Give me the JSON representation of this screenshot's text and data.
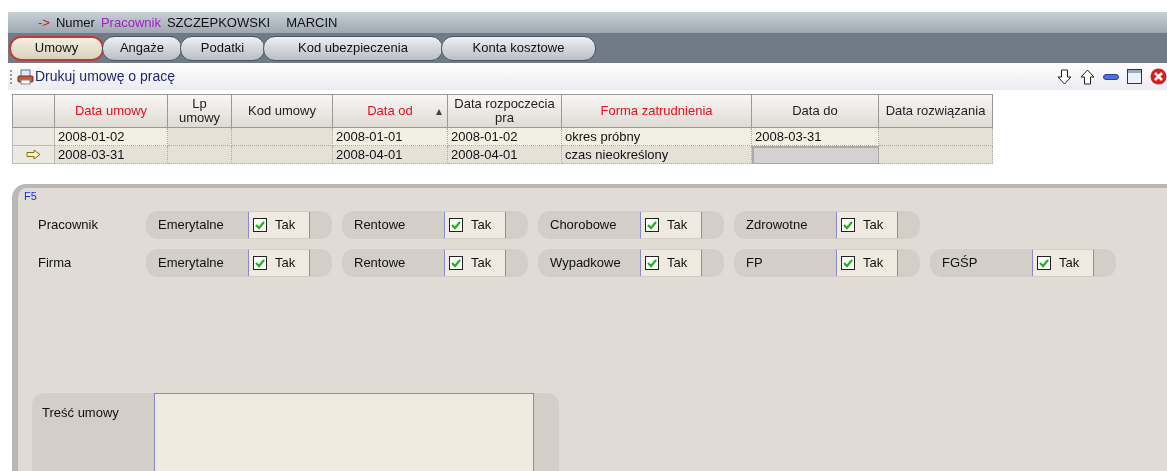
{
  "header": {
    "arrow": "->",
    "number_label": "Numer",
    "employee_label": "Pracownik",
    "last_name": "SZCZEPKOWSKI",
    "first_name": "MARCIN"
  },
  "tabs": [
    {
      "label": "Umowy",
      "selected": true
    },
    {
      "label": "Angaże",
      "selected": false
    },
    {
      "label": "Podatki",
      "selected": false
    },
    {
      "label": "Kod ubezpieczenia",
      "selected": false
    },
    {
      "label": "Konta kosztowe",
      "selected": false
    }
  ],
  "toolbar": {
    "print_button": "Drukuj umowę o pracę"
  },
  "table": {
    "columns": [
      {
        "label": "Data umowy",
        "required": true,
        "sorted": false
      },
      {
        "label": "Lp umowy",
        "required": false,
        "sorted": false
      },
      {
        "label": "Kod umowy",
        "required": false,
        "sorted": false
      },
      {
        "label": "Data od",
        "required": true,
        "sorted": true
      },
      {
        "label": "Data rozpoczecia pra",
        "required": false,
        "sorted": false
      },
      {
        "label": "Forma zatrudnienia",
        "required": true,
        "sorted": false
      },
      {
        "label": "Data do",
        "required": false,
        "sorted": false
      },
      {
        "label": "Data rozwiązania",
        "required": false,
        "sorted": false
      }
    ],
    "rows": [
      {
        "current": false,
        "cells": [
          "2008-01-02",
          null,
          null,
          "2008-01-01",
          "2008-01-02",
          "okres próbny",
          "2008-03-31",
          null
        ]
      },
      {
        "current": true,
        "cells": [
          "2008-03-31",
          null,
          null,
          "2008-04-01",
          "2008-04-01",
          "czas nieokreślony",
          null,
          null
        ]
      }
    ]
  },
  "panel": {
    "title": "F5",
    "groups": [
      {
        "label": "Pracownik",
        "items": [
          {
            "label": "Emerytalne",
            "checked": true,
            "value": "Tak"
          },
          {
            "label": "Rentowe",
            "checked": true,
            "value": "Tak"
          },
          {
            "label": "Chorobowe",
            "checked": true,
            "value": "Tak"
          },
          {
            "label": "Zdrowotne",
            "checked": true,
            "value": "Tak"
          }
        ]
      },
      {
        "label": "Firma",
        "items": [
          {
            "label": "Emerytalne",
            "checked": true,
            "value": "Tak"
          },
          {
            "label": "Rentowe",
            "checked": true,
            "value": "Tak"
          },
          {
            "label": "Wypadkowe",
            "checked": true,
            "value": "Tak"
          },
          {
            "label": "FP",
            "checked": true,
            "value": "Tak"
          },
          {
            "label": "FGŚP",
            "checked": true,
            "value": "Tak"
          }
        ]
      }
    ],
    "contract_text": {
      "label": "Treść umowy"
    }
  }
}
